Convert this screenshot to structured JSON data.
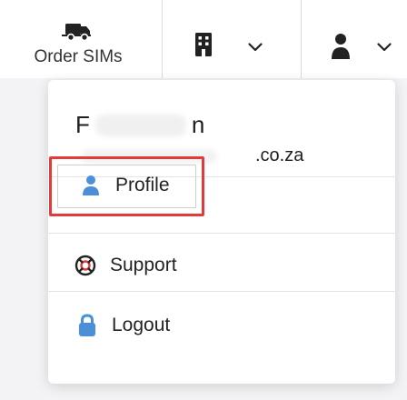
{
  "topbar": {
    "order_sims": {
      "label": "Order SIMs",
      "icon": "truck-icon"
    },
    "org_switcher": {
      "icon": "building-icon",
      "chevron": "chevron-down-icon"
    },
    "account": {
      "icon": "user-icon",
      "chevron": "chevron-down-icon"
    }
  },
  "dropdown": {
    "user_name_start": "F",
    "user_name_end": "n",
    "email_suffix": ".co.za",
    "items": [
      {
        "label": "Profile",
        "icon": "user-icon"
      },
      {
        "label": "Support",
        "icon": "lifebuoy-icon"
      },
      {
        "label": "Logout",
        "icon": "lock-icon"
      }
    ]
  },
  "colors": {
    "accent": "#4a90d9",
    "highlight": "#e33b3b",
    "icon_dark": "#222222"
  }
}
